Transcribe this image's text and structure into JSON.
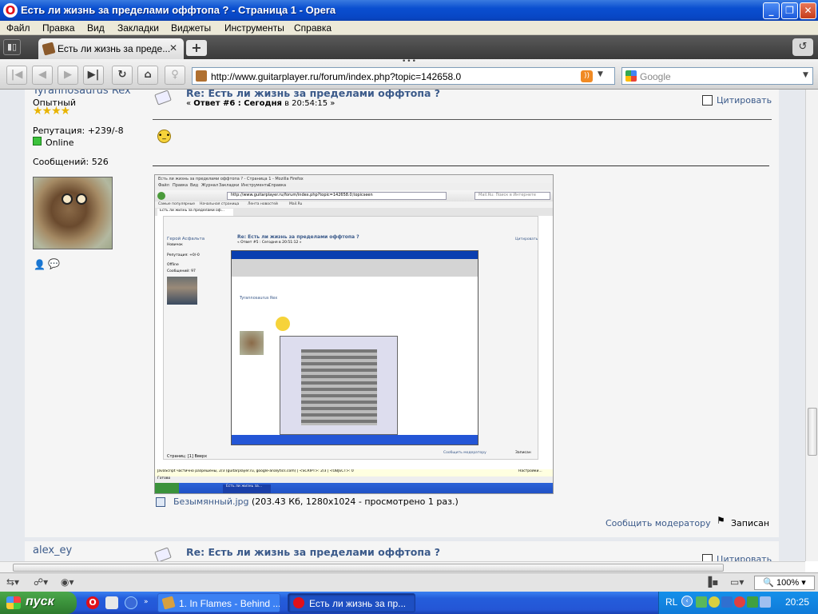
{
  "window": {
    "title": "Есть ли жизнь за пределами оффтопа ? - Страница 1 - Opera",
    "controls": [
      "_",
      "❐",
      "✕"
    ]
  },
  "menu": [
    "Файл",
    "Правка",
    "Вид",
    "Закладки",
    "Виджеты",
    "Инструменты",
    "Справка"
  ],
  "tabs": [
    {
      "label": "Есть ли жизнь за преде...",
      "active": true
    }
  ],
  "toolbar": {
    "url": "http://www.guitarplayer.ru/forum/index.php?topic=142658.0",
    "search_engine": "Google"
  },
  "post1": {
    "author": "Tyrannosaurus Rex",
    "rank": "Опытный",
    "stars": "★★★★",
    "reputation": "Репутация: +239/-8",
    "online": "Online",
    "messages": "Сообщений: 526",
    "title": "Re: Есть ли жизнь за пределами оффтопа ?",
    "meta_prefix": "« ",
    "meta_bold": "Ответ #6 : Сегодня",
    "meta_rest": " в 20:54:15 »",
    "quote_label": "Цитировать",
    "attachment_name": "Безымянный.jpg",
    "attachment_info": "(203.43 Кб, 1280x1024 - просмотрено 1 раз.)",
    "report": "Сообщить модератору",
    "logged": "Записан"
  },
  "post2": {
    "author": "alex_ey",
    "title": "Re: Есть ли жизнь за пределами оффтопа ?",
    "quote_label": "Цитировать"
  },
  "nested_screenshot": {
    "title": "Есть ли жизнь за пределами оффтопа ? - Страница 1 - Mozilla Firefox",
    "menu": [
      "Файл",
      "Правка",
      "Вид",
      "Журнал",
      "Закладки",
      "Инструменты",
      "Справка"
    ],
    "url": "http://www.guitarplayer.ru/forum/index.php?topic=142658.0;topicseen",
    "search_placeholder": "Mail.Ru: Поиск в Интернете",
    "bookmarks": [
      "Самые популярные",
      "Начальная страница",
      "Лента новостей",
      "Mail.Ru"
    ],
    "tab": "Есть ли жизнь за пределами оф...",
    "author": "Герой Асфальта",
    "rank": "Новичок",
    "reputation": "Репутация: +0/-0",
    "status": "Offline",
    "messages": "Сообщений: 97",
    "post_title": "Re: Есть ли жизнь за пределами оффтопа ?",
    "post_meta": "« Ответ #5 : Сегодня в 20:51:12 »",
    "quote": "Цитировать",
    "inner_author": "Tyrannosaurus Rex",
    "report": "Сообщить модератору",
    "logged": "Записан",
    "pages": "Страниц: [1]   Вверх",
    "status_bar": "JavaScript частично разрешены, 2/3 (guitarplayer.ru, google-analytics.com) | <SCRIPT>: 2/3 | <OBJECT>: 0",
    "status_btn": "Настройки...",
    "done": "Готово",
    "taskbar_item": "Есть ли жизнь за..."
  },
  "statusbar": {
    "zoom": "100%"
  },
  "taskbar": {
    "start": "пуск",
    "tasks": [
      {
        "label": "1. In Flames - Behind ...",
        "active": false
      },
      {
        "label": "Есть ли жизнь за пр...",
        "active": true
      }
    ],
    "lang": "RL",
    "clock": "20:25"
  },
  "colors": {
    "link": "#3b5a8a",
    "title_bar": "#0a4fd0",
    "taskbar": "#245ddb",
    "start": "#3b923b"
  }
}
